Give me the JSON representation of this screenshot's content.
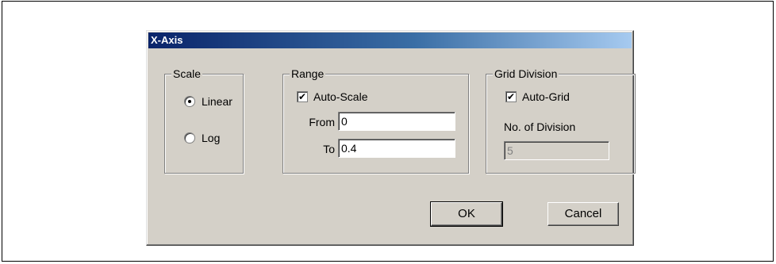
{
  "dialog": {
    "title": "X-Axis"
  },
  "scale": {
    "group_label": "Scale",
    "options": [
      {
        "label": "Linear",
        "checked": true
      },
      {
        "label": "Log",
        "checked": false
      }
    ]
  },
  "range": {
    "group_label": "Range",
    "autoscale_label": "Auto-Scale",
    "autoscale_checked": true,
    "from_label": "From",
    "from_value": "0",
    "to_label": "To",
    "to_value": "0.4"
  },
  "grid": {
    "group_label": "Grid Division",
    "autogrid_label": "Auto-Grid",
    "autogrid_checked": true,
    "divisions_label": "No. of Division",
    "divisions_value": "5"
  },
  "buttons": {
    "ok_label": "OK",
    "cancel_label": "Cancel"
  },
  "icons": {
    "check_glyph": "✔"
  }
}
